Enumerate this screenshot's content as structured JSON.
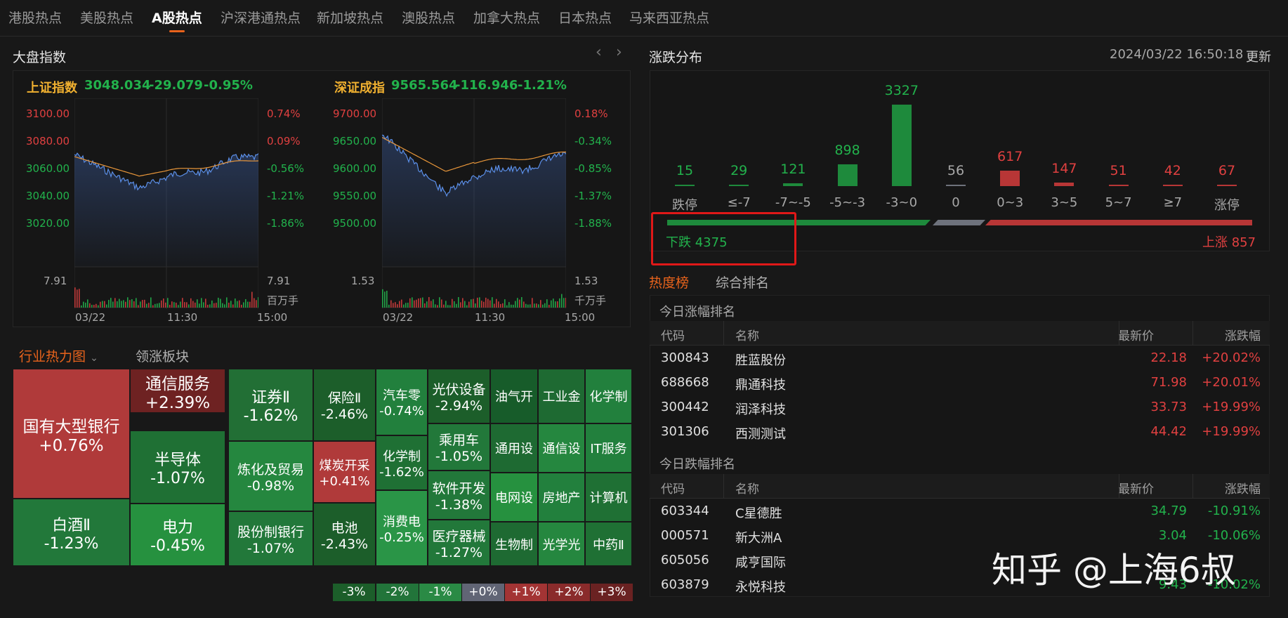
{
  "tabs": [
    "港股热点",
    "美股热点",
    "A股热点",
    "沪深港通热点",
    "新加坡热点",
    "澳股热点",
    "加拿大热点",
    "日本热点",
    "马来西亚热点"
  ],
  "active_tab": "A股热点",
  "market": {
    "title": "大盘指数",
    "prev_icon": "chevron-left-icon",
    "next_icon": "chevron-right-icon",
    "indices": [
      {
        "name": "上证指数",
        "value": "3048.034",
        "change": "-29.079",
        "pct": "-0.95%",
        "y_labels": [
          "3100.00",
          "3080.00",
          "3060.00",
          "3040.00",
          "3020.00"
        ],
        "pct_labels": [
          "0.74%",
          "0.09%",
          "-0.56%",
          "-1.21%",
          "-1.86%"
        ],
        "vol_left": "7.91",
        "vol_right": "7.91",
        "vol_unit": "百万手",
        "times": [
          "03/22",
          "11:30",
          "15:00"
        ]
      },
      {
        "name": "深证成指",
        "value": "9565.564",
        "change": "-116.946",
        "pct": "-1.21%",
        "y_labels": [
          "9700.00",
          "9650.00",
          "9600.00",
          "9550.00",
          "9500.00"
        ],
        "pct_labels": [
          "0.18%",
          "-0.34%",
          "-0.85%",
          "-1.37%",
          "-1.88%"
        ],
        "vol_left": "1.53",
        "vol_right": "1.53",
        "vol_unit": "千万手",
        "times": [
          "03/22",
          "11:30",
          "15:00"
        ]
      }
    ]
  },
  "heatmap": {
    "tab_active": "行业热力图",
    "tab_other": "领涨板块",
    "dropdown_icon": "chevron-down-icon",
    "cells": [
      {
        "name": "国有大型银行",
        "pct": "+0.76%"
      },
      {
        "name": "通信服务",
        "pct": "+2.39%"
      },
      {
        "name": "证券Ⅱ",
        "pct": "-1.62%"
      },
      {
        "name": "保险Ⅱ",
        "pct": "-2.46%"
      },
      {
        "name": "汽车零",
        "pct": "-0.74%"
      },
      {
        "name": "光伏设备",
        "pct": "-2.94%"
      },
      {
        "name": "油气开",
        "pct": ""
      },
      {
        "name": "工业金",
        "pct": ""
      },
      {
        "name": "化学制",
        "pct": ""
      },
      {
        "name": "半导体",
        "pct": "-1.07%"
      },
      {
        "name": "炼化及贸易",
        "pct": "-0.98%"
      },
      {
        "name": "煤炭开采",
        "pct": "+0.41%"
      },
      {
        "name": "化学制",
        "pct": "-1.62%"
      },
      {
        "name": "乘用车",
        "pct": "-1.05%"
      },
      {
        "name": "通用设",
        "pct": ""
      },
      {
        "name": "通信设",
        "pct": ""
      },
      {
        "name": "IT服务",
        "pct": ""
      },
      {
        "name": "软件开发",
        "pct": "-1.38%"
      },
      {
        "name": "电网设",
        "pct": ""
      },
      {
        "name": "房地产",
        "pct": ""
      },
      {
        "name": "计算机",
        "pct": ""
      },
      {
        "name": "白酒Ⅱ",
        "pct": "-1.23%"
      },
      {
        "name": "电力",
        "pct": "-0.45%"
      },
      {
        "name": "股份制银行",
        "pct": "-1.07%"
      },
      {
        "name": "电池",
        "pct": "-2.43%"
      },
      {
        "name": "消费电",
        "pct": "-0.25%"
      },
      {
        "name": "医疗器械",
        "pct": "-1.27%"
      },
      {
        "name": "生物制",
        "pct": ""
      },
      {
        "name": "光学光",
        "pct": ""
      },
      {
        "name": "中药Ⅱ",
        "pct": ""
      }
    ],
    "legend": [
      "-3%",
      "-2%",
      "-1%",
      "+0%",
      "+1%",
      "+2%",
      "+3%"
    ]
  },
  "distribution": {
    "title": "涨跌分布",
    "datetime": "2024/03/22 16:50:18",
    "refresh": "更新",
    "buckets": [
      {
        "label": "跌停",
        "count": "15"
      },
      {
        "label": "≤-7",
        "count": "29"
      },
      {
        "label": "-7~-5",
        "count": "121"
      },
      {
        "label": "-5~-3",
        "count": "898"
      },
      {
        "label": "-3~0",
        "count": "3327"
      },
      {
        "label": "0",
        "count": "56"
      },
      {
        "label": "0~3",
        "count": "617"
      },
      {
        "label": "3~5",
        "count": "147"
      },
      {
        "label": "5~7",
        "count": "51"
      },
      {
        "label": "≥7",
        "count": "42"
      },
      {
        "label": "涨停",
        "count": "67"
      }
    ],
    "down_text": "下跌 4375",
    "up_text": "上涨 857"
  },
  "ranking": {
    "tab_active": "热度榜",
    "tab_other": "综合排名",
    "gain_title": "今日涨幅排名",
    "loss_title": "今日跌幅排名",
    "columns": [
      "代码",
      "名称",
      "最新价",
      "涨跌幅"
    ],
    "gainers": [
      {
        "code": "300843",
        "name": "胜蓝股份",
        "price": "22.18",
        "pct": "+20.02%"
      },
      {
        "code": "688668",
        "name": "鼎通科技",
        "price": "71.98",
        "pct": "+20.01%"
      },
      {
        "code": "300442",
        "name": "润泽科技",
        "price": "33.73",
        "pct": "+19.99%"
      },
      {
        "code": "301306",
        "name": "西测测试",
        "price": "44.42",
        "pct": "+19.99%"
      }
    ],
    "losers": [
      {
        "code": "603344",
        "name": "C星德胜",
        "price": "34.79",
        "pct": "-10.91%"
      },
      {
        "code": "000571",
        "name": "新大洲A",
        "price": "3.04",
        "pct": "-10.06%"
      },
      {
        "code": "605056",
        "name": "咸亨国际",
        "price": "",
        "pct": ""
      },
      {
        "code": "603879",
        "name": "永悦科技",
        "price": "9.43",
        "pct": "-10.02%"
      }
    ]
  },
  "watermark": "知乎 @上海6叔"
}
